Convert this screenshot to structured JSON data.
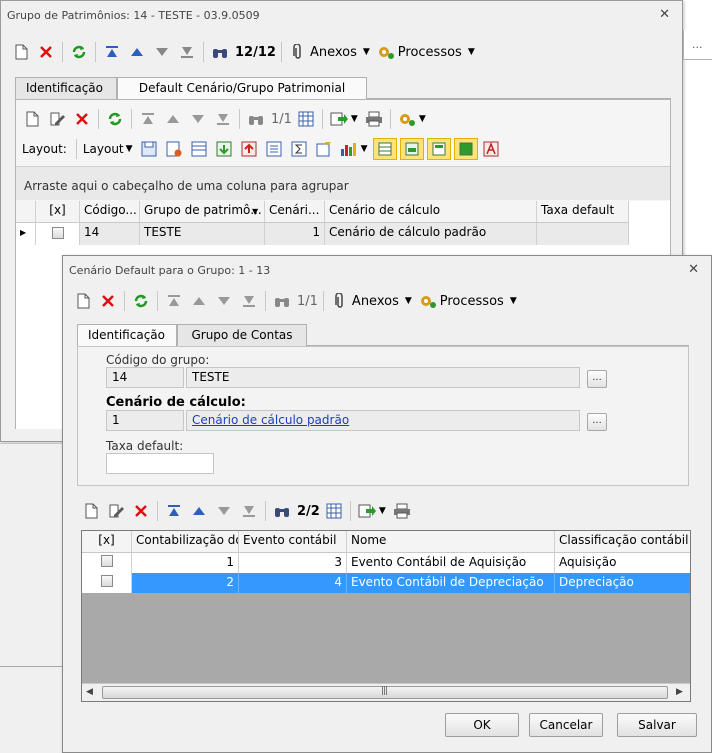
{
  "bg_window": {
    "title": "Grupo de Patrimônios: 14 - TESTE - 03.9.0509",
    "close": "✕",
    "toolbar": {
      "record_nav": "12/12",
      "anexos": "Anexos",
      "processos": "Processos"
    },
    "tabs": [
      "Identificação",
      "Default Cenário/Grupo Patrimonial"
    ],
    "inner_toolbar": {
      "record_nav": "1/1"
    },
    "layout_bar": {
      "layout_label": "Layout:",
      "layout_menu": "Layout"
    },
    "group_hint": "Arraste aqui o cabeçalho de uma coluna para agrupar",
    "grid": {
      "columns": [
        "[x]",
        "Código...",
        "Grupo de patrimô...",
        "Cenári...",
        "Cenário de cálculo",
        "Taxa default"
      ],
      "rows": [
        {
          "codigo": "14",
          "grupo": "TESTE",
          "cenario_num": "1",
          "cenario": "Cenário de cálculo padrão",
          "taxa": ""
        }
      ]
    }
  },
  "right_edge_dots": "...",
  "fg_window": {
    "title": "Cenário Default para o Grupo: 1 - 13",
    "close": "✕",
    "toolbar": {
      "record_nav": "1/1",
      "anexos": "Anexos",
      "processos": "Processos"
    },
    "tabs": [
      "Identificação",
      "Grupo de Contas"
    ],
    "form": {
      "codigo_label": "Código do grupo:",
      "codigo_value": "14",
      "grupo_name": "TESTE",
      "cenario_label": "Cenário de cálculo:",
      "cenario_value": "1",
      "cenario_name": "Cenário de cálculo padrão",
      "taxa_label": "Taxa default:",
      "taxa_value": "",
      "dots": "..."
    },
    "grid_toolbar": {
      "record_nav": "2/2"
    },
    "grid": {
      "columns": [
        "[x]",
        "Contabilização do",
        "Evento contábil",
        "Nome",
        "Classificação contábil"
      ],
      "rows": [
        {
          "contab": "1",
          "evento": "3",
          "nome": "Evento Contábil de Aquisição",
          "classif": "Aquisição"
        },
        {
          "contab": "2",
          "evento": "4",
          "nome": "Evento Contábil de Depreciação",
          "classif": "Depreciação"
        }
      ],
      "selected_color": "#3399ff"
    },
    "buttons": {
      "ok": "OK",
      "cancel": "Cancelar",
      "save": "Salvar"
    }
  }
}
